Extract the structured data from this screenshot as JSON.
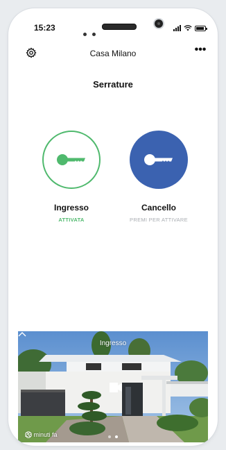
{
  "status_bar": {
    "time": "15:23"
  },
  "header": {
    "home_name": "Casa Milano",
    "more_label": "•••"
  },
  "section_title": "Serrature",
  "locks": [
    {
      "name": "Ingresso",
      "state": "ATTIVATA",
      "active": true
    },
    {
      "name": "Cancello",
      "state": "PREMI PER ATTIVARE",
      "active": false
    }
  ],
  "camera": {
    "label": "Ingresso",
    "timestamp": "23 minuti fa"
  },
  "colors": {
    "active_green": "#4fb96d",
    "lock_blue": "#3b62b0",
    "muted": "#a8acb1"
  }
}
